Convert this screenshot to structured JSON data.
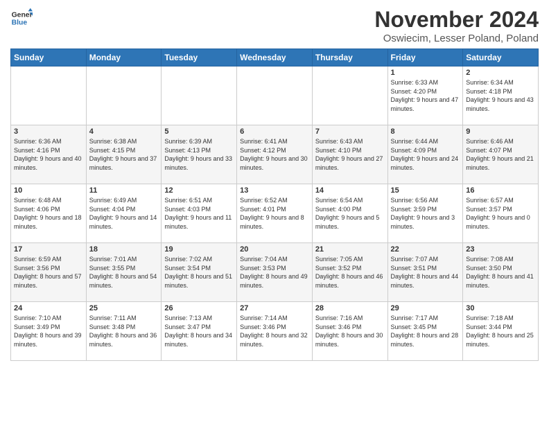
{
  "logo": {
    "line1": "General",
    "line2": "Blue"
  },
  "title": "November 2024",
  "location": "Oswiecim, Lesser Poland, Poland",
  "weekdays": [
    "Sunday",
    "Monday",
    "Tuesday",
    "Wednesday",
    "Thursday",
    "Friday",
    "Saturday"
  ],
  "weeks": [
    [
      {
        "day": "",
        "info": ""
      },
      {
        "day": "",
        "info": ""
      },
      {
        "day": "",
        "info": ""
      },
      {
        "day": "",
        "info": ""
      },
      {
        "day": "",
        "info": ""
      },
      {
        "day": "1",
        "info": "Sunrise: 6:33 AM\nSunset: 4:20 PM\nDaylight: 9 hours\nand 47 minutes."
      },
      {
        "day": "2",
        "info": "Sunrise: 6:34 AM\nSunset: 4:18 PM\nDaylight: 9 hours\nand 43 minutes."
      }
    ],
    [
      {
        "day": "3",
        "info": "Sunrise: 6:36 AM\nSunset: 4:16 PM\nDaylight: 9 hours\nand 40 minutes."
      },
      {
        "day": "4",
        "info": "Sunrise: 6:38 AM\nSunset: 4:15 PM\nDaylight: 9 hours\nand 37 minutes."
      },
      {
        "day": "5",
        "info": "Sunrise: 6:39 AM\nSunset: 4:13 PM\nDaylight: 9 hours\nand 33 minutes."
      },
      {
        "day": "6",
        "info": "Sunrise: 6:41 AM\nSunset: 4:12 PM\nDaylight: 9 hours\nand 30 minutes."
      },
      {
        "day": "7",
        "info": "Sunrise: 6:43 AM\nSunset: 4:10 PM\nDaylight: 9 hours\nand 27 minutes."
      },
      {
        "day": "8",
        "info": "Sunrise: 6:44 AM\nSunset: 4:09 PM\nDaylight: 9 hours\nand 24 minutes."
      },
      {
        "day": "9",
        "info": "Sunrise: 6:46 AM\nSunset: 4:07 PM\nDaylight: 9 hours\nand 21 minutes."
      }
    ],
    [
      {
        "day": "10",
        "info": "Sunrise: 6:48 AM\nSunset: 4:06 PM\nDaylight: 9 hours\nand 18 minutes."
      },
      {
        "day": "11",
        "info": "Sunrise: 6:49 AM\nSunset: 4:04 PM\nDaylight: 9 hours\nand 14 minutes."
      },
      {
        "day": "12",
        "info": "Sunrise: 6:51 AM\nSunset: 4:03 PM\nDaylight: 9 hours\nand 11 minutes."
      },
      {
        "day": "13",
        "info": "Sunrise: 6:52 AM\nSunset: 4:01 PM\nDaylight: 9 hours\nand 8 minutes."
      },
      {
        "day": "14",
        "info": "Sunrise: 6:54 AM\nSunset: 4:00 PM\nDaylight: 9 hours\nand 5 minutes."
      },
      {
        "day": "15",
        "info": "Sunrise: 6:56 AM\nSunset: 3:59 PM\nDaylight: 9 hours\nand 3 minutes."
      },
      {
        "day": "16",
        "info": "Sunrise: 6:57 AM\nSunset: 3:57 PM\nDaylight: 9 hours\nand 0 minutes."
      }
    ],
    [
      {
        "day": "17",
        "info": "Sunrise: 6:59 AM\nSunset: 3:56 PM\nDaylight: 8 hours\nand 57 minutes."
      },
      {
        "day": "18",
        "info": "Sunrise: 7:01 AM\nSunset: 3:55 PM\nDaylight: 8 hours\nand 54 minutes."
      },
      {
        "day": "19",
        "info": "Sunrise: 7:02 AM\nSunset: 3:54 PM\nDaylight: 8 hours\nand 51 minutes."
      },
      {
        "day": "20",
        "info": "Sunrise: 7:04 AM\nSunset: 3:53 PM\nDaylight: 8 hours\nand 49 minutes."
      },
      {
        "day": "21",
        "info": "Sunrise: 7:05 AM\nSunset: 3:52 PM\nDaylight: 8 hours\nand 46 minutes."
      },
      {
        "day": "22",
        "info": "Sunrise: 7:07 AM\nSunset: 3:51 PM\nDaylight: 8 hours\nand 44 minutes."
      },
      {
        "day": "23",
        "info": "Sunrise: 7:08 AM\nSunset: 3:50 PM\nDaylight: 8 hours\nand 41 minutes."
      }
    ],
    [
      {
        "day": "24",
        "info": "Sunrise: 7:10 AM\nSunset: 3:49 PM\nDaylight: 8 hours\nand 39 minutes."
      },
      {
        "day": "25",
        "info": "Sunrise: 7:11 AM\nSunset: 3:48 PM\nDaylight: 8 hours\nand 36 minutes."
      },
      {
        "day": "26",
        "info": "Sunrise: 7:13 AM\nSunset: 3:47 PM\nDaylight: 8 hours\nand 34 minutes."
      },
      {
        "day": "27",
        "info": "Sunrise: 7:14 AM\nSunset: 3:46 PM\nDaylight: 8 hours\nand 32 minutes."
      },
      {
        "day": "28",
        "info": "Sunrise: 7:16 AM\nSunset: 3:46 PM\nDaylight: 8 hours\nand 30 minutes."
      },
      {
        "day": "29",
        "info": "Sunrise: 7:17 AM\nSunset: 3:45 PM\nDaylight: 8 hours\nand 28 minutes."
      },
      {
        "day": "30",
        "info": "Sunrise: 7:18 AM\nSunset: 3:44 PM\nDaylight: 8 hours\nand 25 minutes."
      }
    ]
  ]
}
